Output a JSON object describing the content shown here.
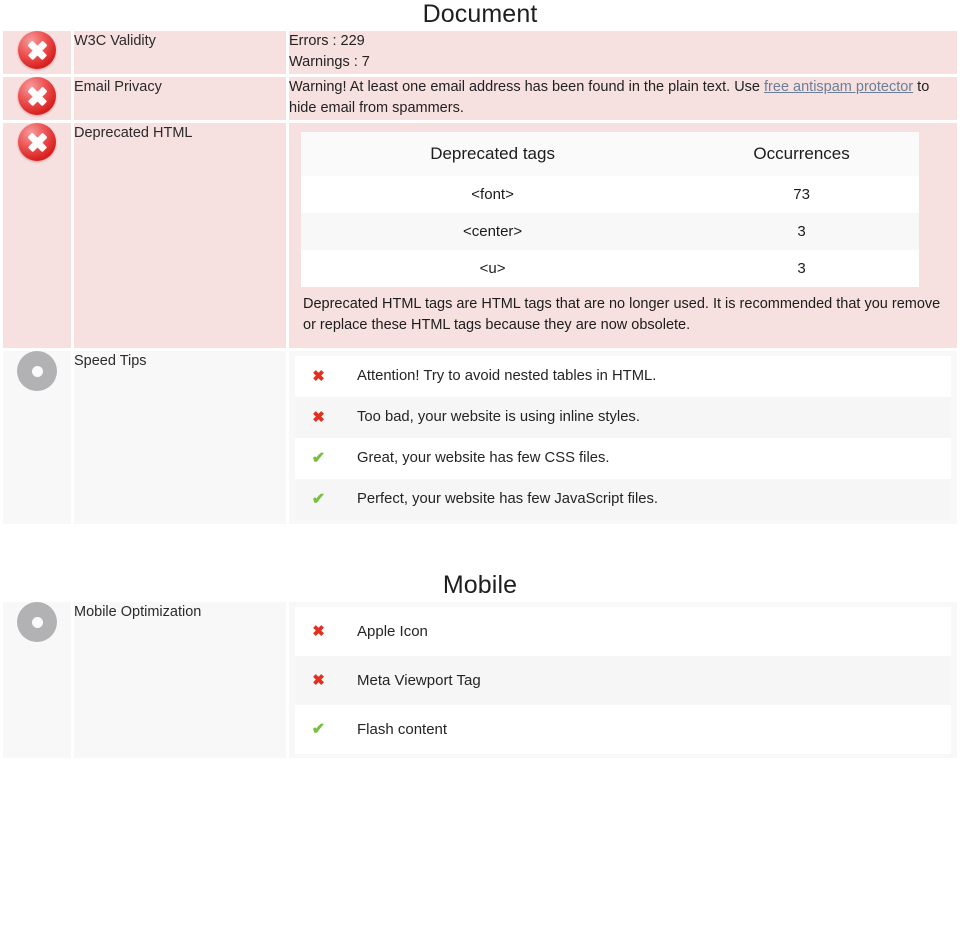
{
  "sections": [
    {
      "id": "document",
      "title": "Document",
      "rows": [
        {
          "id": "w3c-validity",
          "status": "error",
          "status_icon": "error-circle-x-icon",
          "label": "W3C Validity",
          "body_type": "lines",
          "lines": [
            "Errors : 229",
            "Warnings : 7"
          ]
        },
        {
          "id": "email-privacy",
          "status": "error",
          "status_icon": "error-circle-x-icon",
          "label": "Email Privacy",
          "body_type": "rich",
          "text_before": "Warning! At least one email address has been found in the plain text. Use ",
          "link_text": "free antispam protector",
          "text_after": " to hide email from spammers."
        },
        {
          "id": "deprecated-html",
          "status": "error",
          "status_icon": "error-circle-x-icon",
          "label": "Deprecated HTML",
          "body_type": "table",
          "table": {
            "headers": [
              "Deprecated tags",
              "Occurrences"
            ],
            "rows": [
              {
                "tag": "<font>",
                "occurrences": "73"
              },
              {
                "tag": "<center>",
                "occurrences": "3"
              },
              {
                "tag": "<u>",
                "occurrences": "3"
              }
            ]
          },
          "note": "Deprecated HTML tags are HTML tags that are no longer used. It is recommended that you remove or replace these HTML tags because they are now obsolete."
        },
        {
          "id": "speed-tips",
          "status": "neutral",
          "status_icon": "neutral-circle-dot-icon",
          "label": "Speed Tips",
          "body_type": "tips",
          "tips": [
            {
              "state": "bad",
              "icon": "red-cross-icon",
              "glyph": "✖",
              "text": "Attention! Try to avoid nested tables in HTML."
            },
            {
              "state": "bad",
              "icon": "red-cross-icon",
              "glyph": "✖",
              "text": "Too bad, your website is using inline styles."
            },
            {
              "state": "good",
              "icon": "green-check-icon",
              "glyph": "✔",
              "text": "Great, your website has few CSS files."
            },
            {
              "state": "good",
              "icon": "green-check-icon",
              "glyph": "✔",
              "text": "Perfect, your website has few JavaScript files."
            }
          ]
        }
      ]
    },
    {
      "id": "mobile",
      "title": "Mobile",
      "rows": [
        {
          "id": "mobile-optimization",
          "status": "neutral",
          "status_icon": "neutral-circle-dot-icon",
          "label": "Mobile Optimization",
          "body_type": "tips",
          "tips": [
            {
              "state": "bad",
              "icon": "red-cross-icon",
              "glyph": "✖",
              "text": "Apple Icon"
            },
            {
              "state": "bad",
              "icon": "red-cross-icon",
              "glyph": "✖",
              "text": "Meta Viewport Tag"
            },
            {
              "state": "good",
              "icon": "green-check-icon",
              "glyph": "✔",
              "text": "Flash content"
            }
          ]
        }
      ]
    }
  ],
  "colors": {
    "error_bg": "#f7e0e0",
    "neutral_bg": "#f8f8f8",
    "error_icon": "#d81f1f",
    "neutral_icon": "#b2b2b4",
    "bad_mark": "#e03020",
    "good_mark": "#79bf3e",
    "link": "#6a7f96",
    "row_alt": "#f6f6f6"
  }
}
